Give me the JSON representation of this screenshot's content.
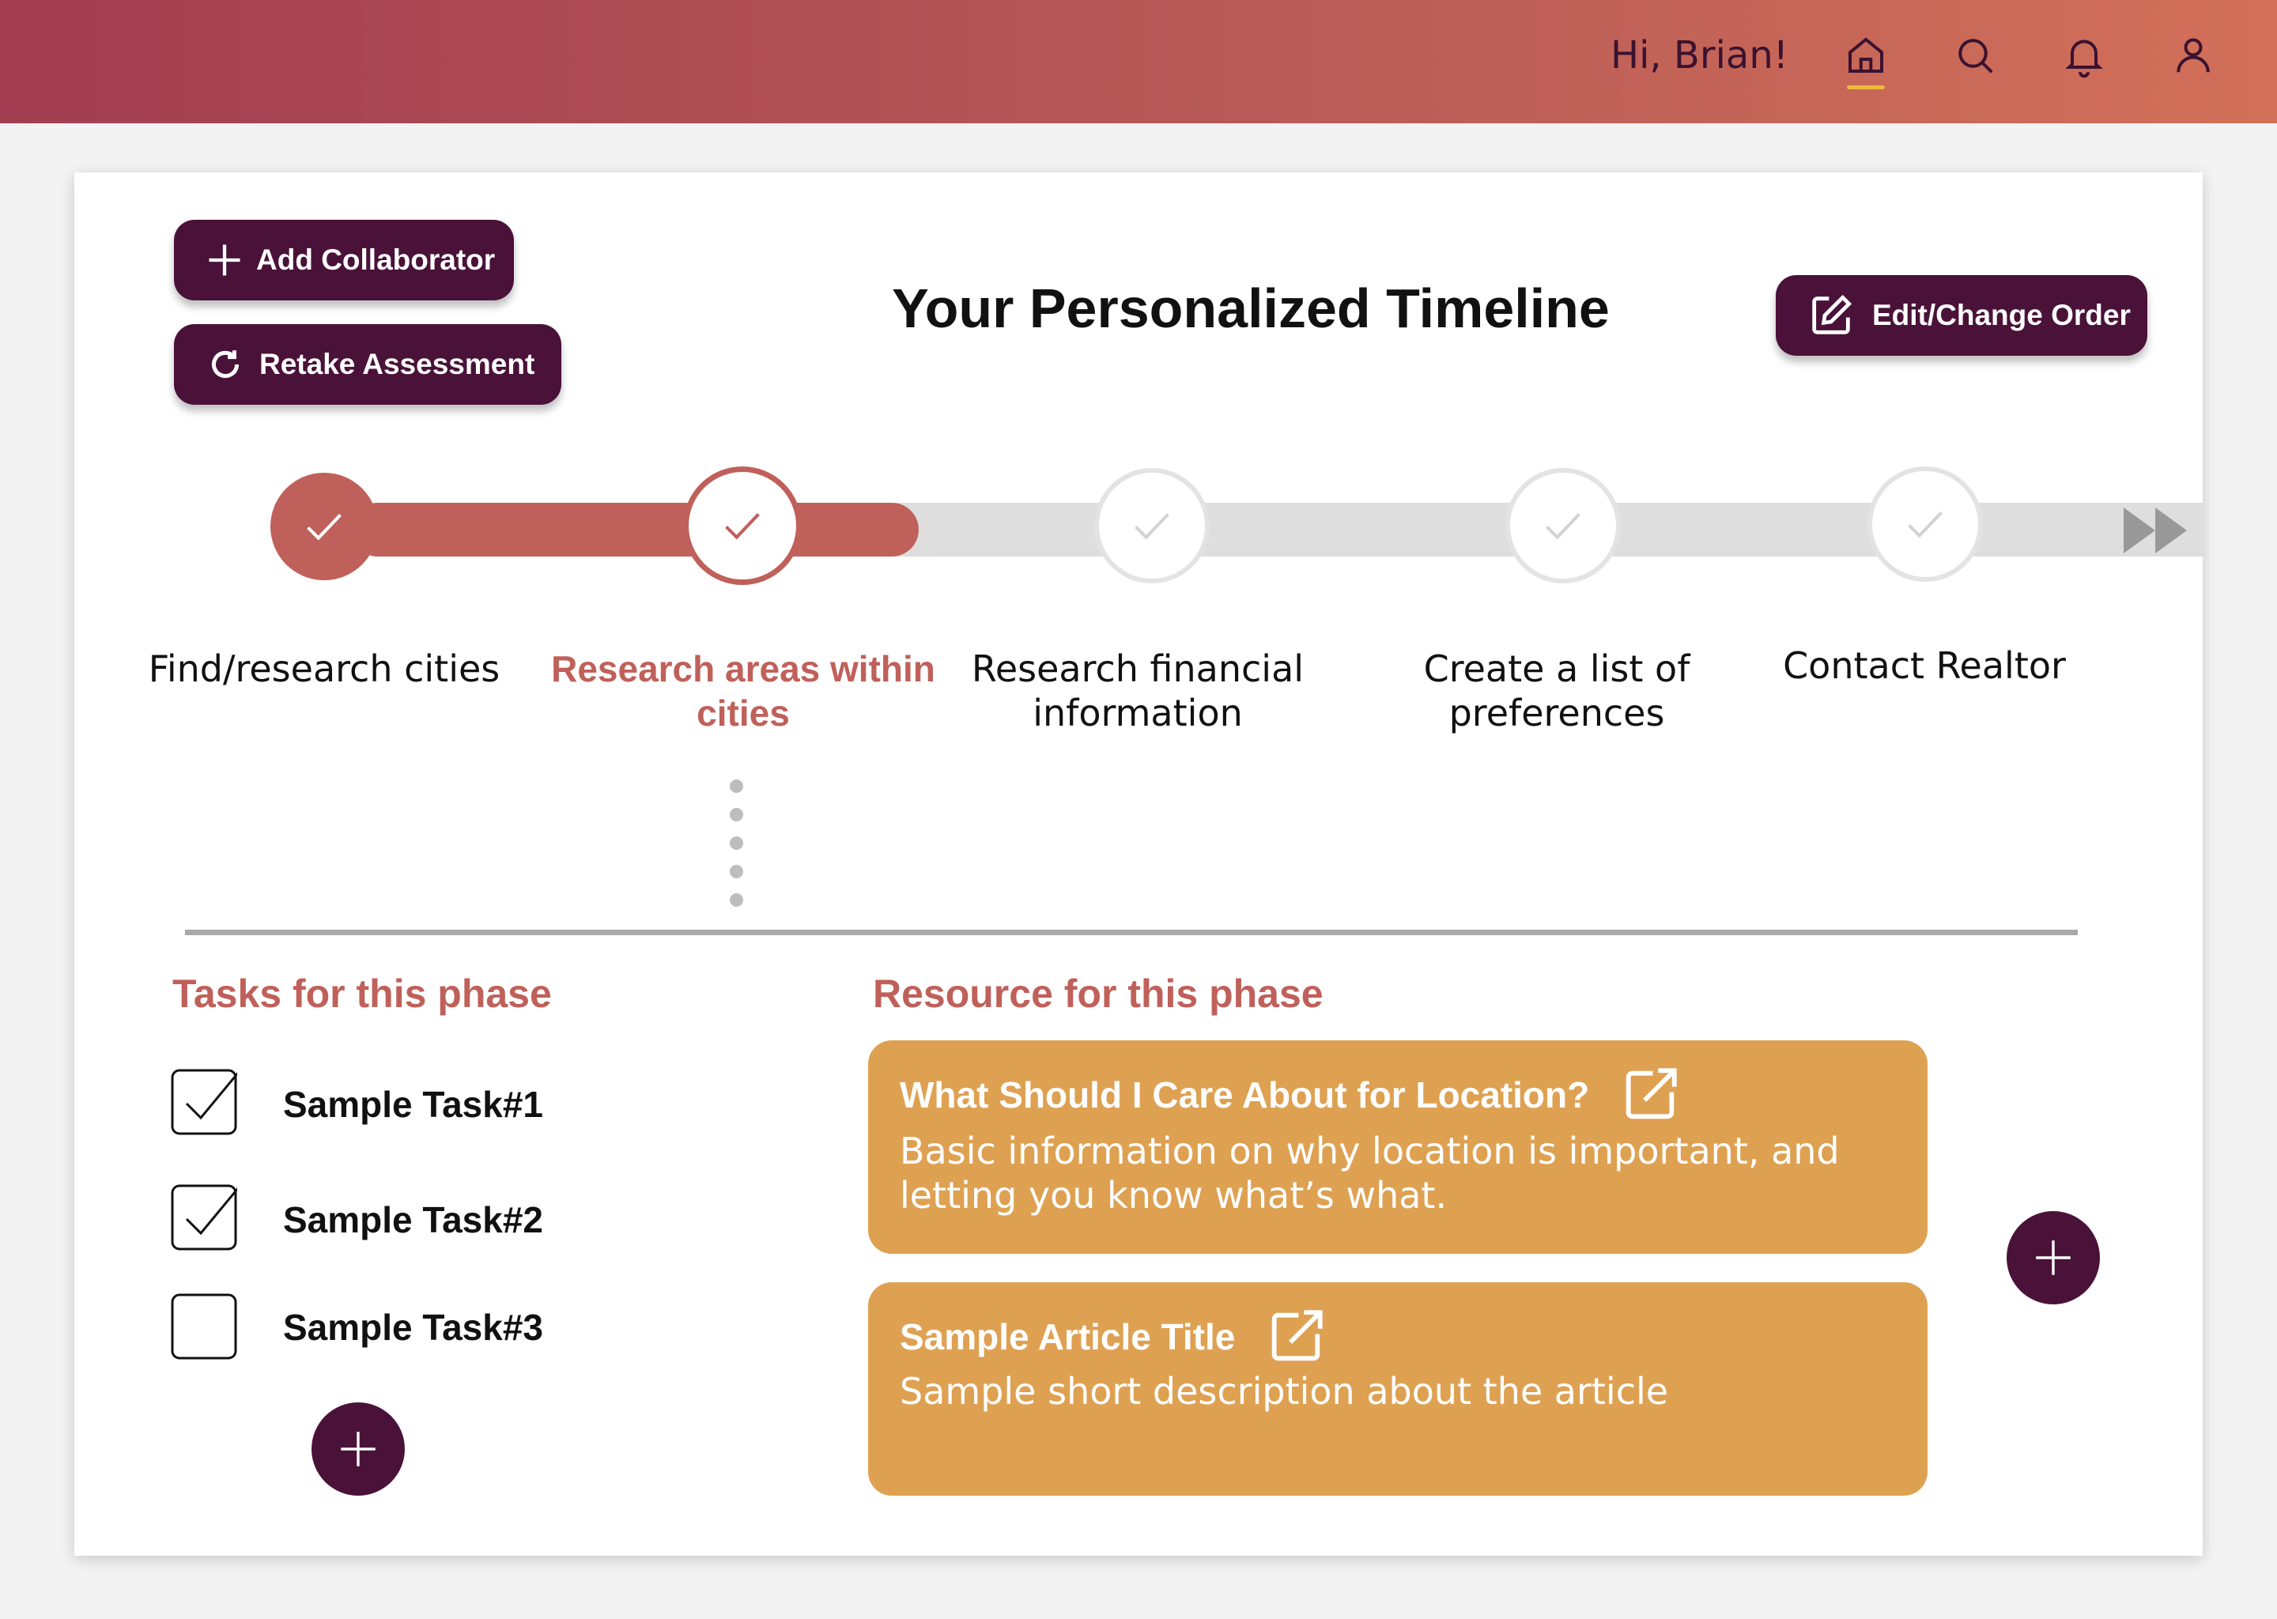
{
  "header": {
    "greeting": "Hi, Brian!",
    "nav_icons": [
      "home-icon",
      "search-icon",
      "bell-icon",
      "user-icon"
    ],
    "active_nav": "home-icon"
  },
  "colors": {
    "header_gradient_start": "#a33d51",
    "header_gradient_end": "#d27059",
    "primary_dark": "#4a1239",
    "accent": "#c0605a",
    "resource_card": "#dea152",
    "track_inactive": "#dedede",
    "nav_active_underline": "#f0b93b"
  },
  "toolbar": {
    "add_collaborator_label": "Add Collaborator",
    "retake_assessment_label": "Retake Assessment",
    "edit_order_label": "Edit/Change Order"
  },
  "timeline": {
    "title": "Your Personalized Timeline",
    "progress_fraction": 0.34,
    "steps": [
      {
        "label": "Find/research cities",
        "status": "completed"
      },
      {
        "label": "Research areas within cities",
        "status": "current"
      },
      {
        "label": "Research financial information",
        "status": "upcoming"
      },
      {
        "label": "Create a list of preferences",
        "status": "upcoming"
      },
      {
        "label": "Contact Realtor",
        "status": "upcoming"
      }
    ]
  },
  "tasks": {
    "title": "Tasks for this phase",
    "items": [
      {
        "label": "Sample Task#1",
        "checked": true
      },
      {
        "label": "Sample Task#2",
        "checked": true
      },
      {
        "label": "Sample Task#3",
        "checked": false
      }
    ]
  },
  "resources": {
    "title": "Resource for this phase",
    "items": [
      {
        "title": "What Should I Care About for Location?",
        "description": "Basic information on why location is important, and letting you know what’s what."
      },
      {
        "title": "Sample Article Title",
        "description": "Sample short description about the article"
      }
    ]
  }
}
